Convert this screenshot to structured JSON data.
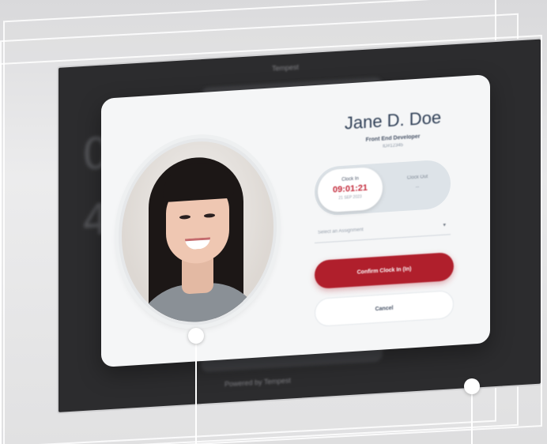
{
  "tablet": {
    "top_label": "Tempest",
    "background_time": [
      "07",
      "42"
    ],
    "footer": "Powered by Tempest"
  },
  "dialog": {
    "employee": {
      "name": "Jane D. Doe",
      "role": "Front End Developer",
      "id": "ID#12345"
    },
    "toggle": {
      "clock_in_label": "Clock In",
      "clock_in_time": "09:01:21",
      "clock_in_date": "21 SEP 2023",
      "clock_out_label": "Clock Out",
      "clock_out_value": "--"
    },
    "select": {
      "placeholder": "Select an Assignment",
      "icon": "chevron-down-icon"
    },
    "buttons": {
      "confirm": "Confirm Clock In (In)",
      "cancel": "Cancel"
    }
  },
  "colors": {
    "accent": "#b01f2c",
    "clock_time": "#c3293a",
    "name": "#2f3f56"
  }
}
